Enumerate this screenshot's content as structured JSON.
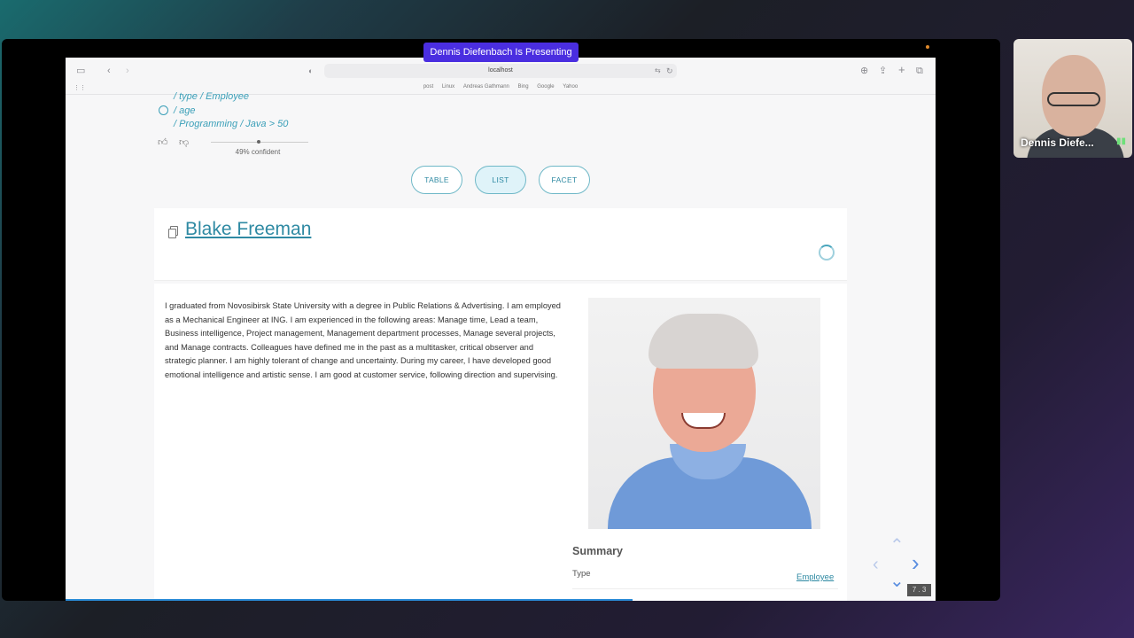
{
  "meeting": {
    "presenting_badge": "Dennis Diefenbach Is Presenting",
    "participant_name": "Dennis Diefe...",
    "slide_number": "7 . 3"
  },
  "browser": {
    "url": "localhost",
    "bookmarks": [
      "post",
      "Linux",
      "Andreas Gathmann",
      "Bing",
      "Google",
      "Yahoo"
    ]
  },
  "query": {
    "filters": [
      "/ type / Employee",
      "/ age",
      "/ Programming / Java > 50"
    ],
    "confidence_text": "49% confident",
    "confidence_value": 0.49
  },
  "views": {
    "table": "TABLE",
    "list": "LIST",
    "facet": "FACET",
    "active": "LIST"
  },
  "result": {
    "name": "Blake Freeman",
    "bio": "I graduated from Novosibirsk State University with a degree in Public Relations & Advertising. I am employed as a Mechanical Engineer at ING. I am experienced in the following areas: Manage time, Lead a team, Business intelligence, Project management, Management department processes, Manage several projects, and Manage contracts. Colleagues have defined me in the past as a multitasker, critical observer and strategic planner. I am highly tolerant of change and uncertainty. During my career, I have developed good emotional intelligence and artistic sense. I am good at customer service, following direction and supervising.",
    "summary_title": "Summary",
    "type_label": "Type",
    "type_value": "Employee"
  },
  "colors": {
    "accent": "#2f8aa3",
    "presenting_badge": "#4a2ee0"
  }
}
